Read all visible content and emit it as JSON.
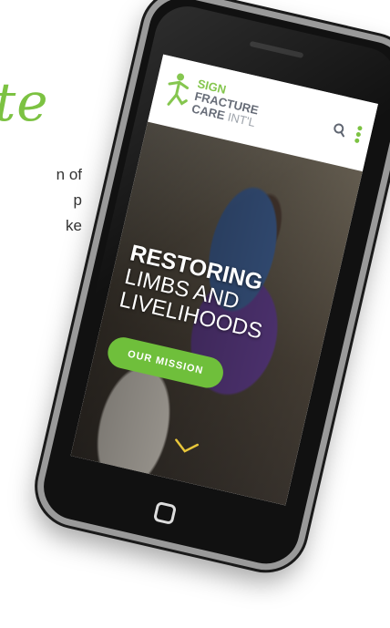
{
  "background_page": {
    "heading_fragment": "te",
    "text_lines": [
      "n of",
      "p",
      "ke"
    ]
  },
  "site": {
    "logo": {
      "line1": "SIGN",
      "line2": "FRACTURE",
      "line3a": "CARE",
      "line3b": "INT'L"
    },
    "header_icons": [
      "search-icon",
      "more-vertical-icon"
    ]
  },
  "hero": {
    "title_bold": "RESTORING",
    "title_line2": "LIMBS AND",
    "title_line3": "LIVELIHOODS",
    "cta_label": "OUR MISSION",
    "scroll_icon": "chevron-down-icon"
  },
  "colors": {
    "brand_green": "#7cc242",
    "logo_gray": "#5e6470"
  }
}
